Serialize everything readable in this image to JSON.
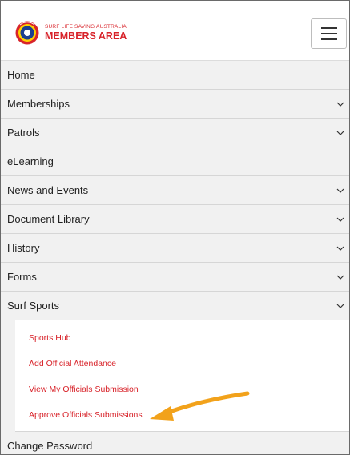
{
  "header": {
    "logo_sub": "SURF LIFE SAVING AUSTRALIA",
    "logo_main": "MEMBERS AREA",
    "menu_icon": "hamburger-menu-icon"
  },
  "nav": {
    "items": [
      {
        "label": "Home",
        "has_chevron": false
      },
      {
        "label": "Memberships",
        "has_chevron": true
      },
      {
        "label": "Patrols",
        "has_chevron": true
      },
      {
        "label": "eLearning",
        "has_chevron": false
      },
      {
        "label": "News and Events",
        "has_chevron": true
      },
      {
        "label": "Document Library",
        "has_chevron": true
      },
      {
        "label": "History",
        "has_chevron": true
      },
      {
        "label": "Forms",
        "has_chevron": true
      },
      {
        "label": "Surf Sports",
        "has_chevron": true,
        "expanded": true
      }
    ],
    "submenu": [
      {
        "label": "Sports Hub"
      },
      {
        "label": "Add Official Attendance"
      },
      {
        "label": "View My Officials Submission"
      },
      {
        "label": "Approve Officials Submissions"
      }
    ],
    "after": {
      "label": "Change Password"
    }
  },
  "colors": {
    "brand_red": "#d8232a",
    "arrow_orange": "#f2a21b",
    "menu_bg": "#f1f1f1"
  }
}
